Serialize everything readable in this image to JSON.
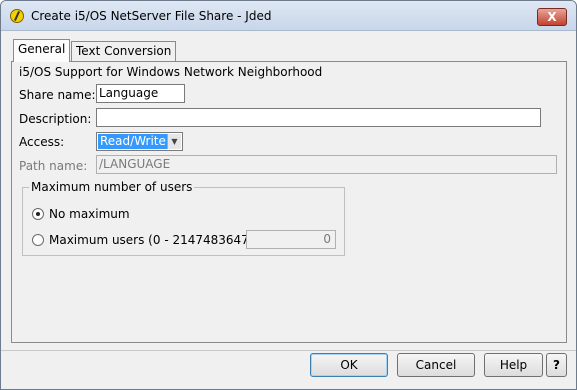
{
  "window": {
    "title": "Create i5/OS NetServer File Share - Jded",
    "close_label": "X"
  },
  "tabs": [
    {
      "label": "General",
      "active": true
    },
    {
      "label": "Text Conversion",
      "active": false
    }
  ],
  "general": {
    "section_heading": "i5/OS Support for Windows Network Neighborhood",
    "share_name_label": "Share name:",
    "share_name_value": "Language",
    "description_label": "Description:",
    "description_value": "",
    "access_label": "Access:",
    "access_value": "Read/Write",
    "path_name_label": "Path name:",
    "path_name_value": "/LANGUAGE"
  },
  "max_users": {
    "group_title": "Maximum number of users",
    "no_maximum_label": "No maximum",
    "no_maximum_selected": true,
    "maximum_users_label": "Maximum users (0 - 2147483647):",
    "maximum_users_value": "0"
  },
  "buttons": {
    "ok": "OK",
    "cancel": "Cancel",
    "help": "Help",
    "question": "?"
  }
}
